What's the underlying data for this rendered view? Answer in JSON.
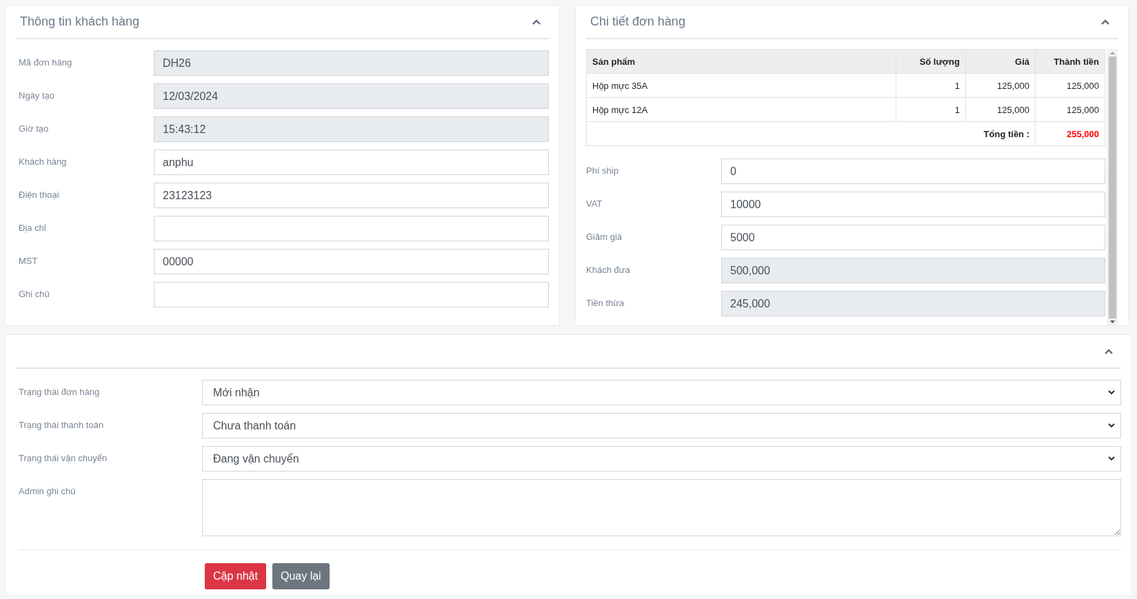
{
  "customer_panel": {
    "title": "Thông tin khách hàng",
    "expanded": true,
    "fields": [
      {
        "label": "Mã đơn hàng",
        "value": "DH26",
        "readonly": true
      },
      {
        "label": "Ngày tạo",
        "value": "12/03/2024",
        "readonly": true
      },
      {
        "label": "Giờ tạo",
        "value": "15:43:12",
        "readonly": true
      },
      {
        "label": "Khách hàng",
        "value": "anphu",
        "readonly": false
      },
      {
        "label": "Điện thoại",
        "value": "23123123",
        "readonly": false
      },
      {
        "label": "Địa chỉ",
        "readonly": false
      },
      {
        "label": "MST",
        "value": "00000",
        "readonly": false
      },
      {
        "label": "Ghi chú",
        "readonly": false
      }
    ]
  },
  "order_panel": {
    "title": "Chi tiết đơn hàng",
    "expanded": true,
    "table": {
      "columns": [
        "Sản phẩm",
        "Số lượng",
        "Giá",
        "Thành tiền"
      ],
      "rows": [
        [
          "Hộp mực 35A",
          "1",
          "125,000",
          "125,000"
        ],
        [
          "Hộp mực 12A",
          "1",
          "125,000",
          "125,000"
        ]
      ],
      "total_label": "Tổng tiền :",
      "total": "255,000"
    },
    "fields": [
      {
        "label": "Phí ship",
        "value": "0",
        "readonly": false
      },
      {
        "label": "VAT",
        "value": "10000",
        "readonly": false
      },
      {
        "label": "Giảm giá",
        "value": "5000",
        "readonly": false
      },
      {
        "label": "Khách đưa",
        "value": "500,000",
        "readonly": true
      },
      {
        "label": "Tiền thừa",
        "value": "245,000",
        "readonly": true
      }
    ]
  },
  "status_panel": {
    "expanded": true,
    "fields": [
      {
        "kind": "select",
        "label": "Trạng thái đơn hàng",
        "value": "Mới nhận"
      },
      {
        "kind": "select",
        "label": "Trạng thái thanh toán",
        "value": "Chưa thanh toán"
      },
      {
        "kind": "select",
        "label": "Trạng thái vận chuyển",
        "value": "Đang vận chuyển"
      },
      {
        "kind": "textarea",
        "label": "Admin ghi chú"
      }
    ],
    "buttons": [
      {
        "label": "Cập nhật",
        "kind": "primary"
      },
      {
        "label": "Quay lại",
        "kind": "secondary"
      }
    ]
  }
}
